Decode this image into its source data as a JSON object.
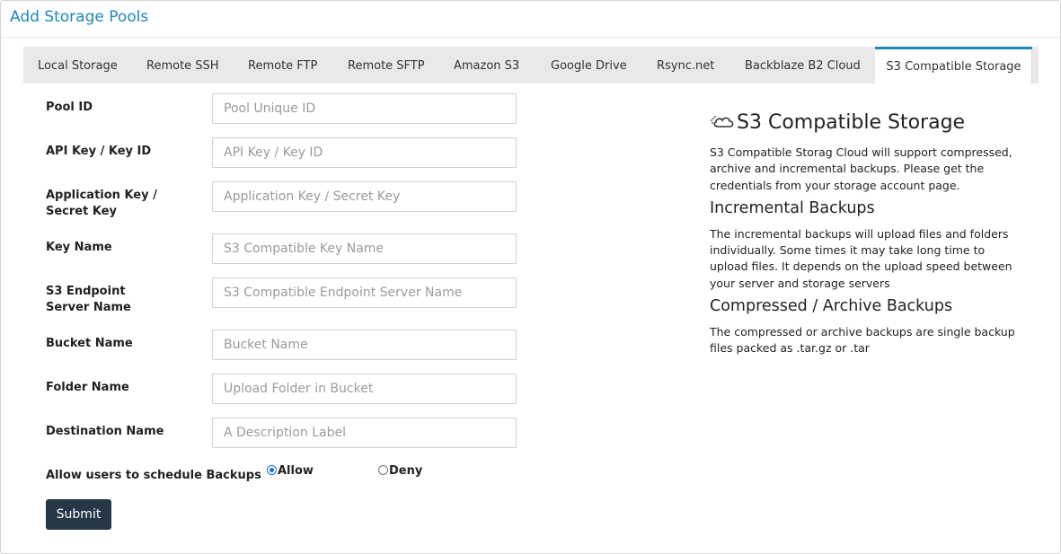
{
  "page": {
    "title": "Add Storage Pools"
  },
  "tabs": [
    {
      "label": "Local Storage",
      "active": false
    },
    {
      "label": "Remote SSH",
      "active": false
    },
    {
      "label": "Remote FTP",
      "active": false
    },
    {
      "label": "Remote SFTP",
      "active": false
    },
    {
      "label": "Amazon S3",
      "active": false
    },
    {
      "label": "Google Drive",
      "active": false
    },
    {
      "label": "Rsync.net",
      "active": false
    },
    {
      "label": "Backblaze B2 Cloud",
      "active": false
    },
    {
      "label": "S3 Compatible Storage",
      "active": true
    }
  ],
  "form": {
    "fields": [
      {
        "label": "Pool ID",
        "placeholder": "Pool Unique ID",
        "value": ""
      },
      {
        "label": "API Key / Key ID",
        "placeholder": "API Key / Key ID",
        "value": ""
      },
      {
        "label": "Application Key / Secret Key",
        "placeholder": "Application Key / Secret Key",
        "value": ""
      },
      {
        "label": "Key Name",
        "placeholder": "S3 Compatible Key Name",
        "value": ""
      },
      {
        "label": "S3 Endpoint Server Name",
        "placeholder": "S3 Compatible Endpoint Server Name",
        "value": ""
      },
      {
        "label": "Bucket Name",
        "placeholder": "Bucket Name",
        "value": ""
      },
      {
        "label": "Folder Name",
        "placeholder": "Upload Folder in Bucket",
        "value": ""
      },
      {
        "label": "Destination Name",
        "placeholder": "A Description Label",
        "value": ""
      }
    ],
    "schedule": {
      "label": "Allow users to schedule Backups",
      "options": [
        {
          "label": "Allow",
          "checked": true
        },
        {
          "label": "Deny",
          "checked": false
        }
      ]
    },
    "submit_label": "Submit"
  },
  "info": {
    "icon": "cloud-icon",
    "title": "S3 Compatible Storage",
    "intro": "S3 Compatible Storag Cloud will support compressed, archive and incremental backups. Please get the credentials from your storage account page.",
    "incremental_title": "Incremental Backups",
    "incremental_text": "The incremental backups will upload files and folders individually. Some times it may take long time to upload files. It depends on the upload speed between your server and storage servers",
    "compressed_title": "Compressed / Archive Backups",
    "compressed_text": "The compressed or archive backups are single backup files packed as .tar.gz or .tar"
  },
  "colors": {
    "accent": "#1f86b8",
    "button": "#263747",
    "tab_bar": "#e9e9e9"
  }
}
